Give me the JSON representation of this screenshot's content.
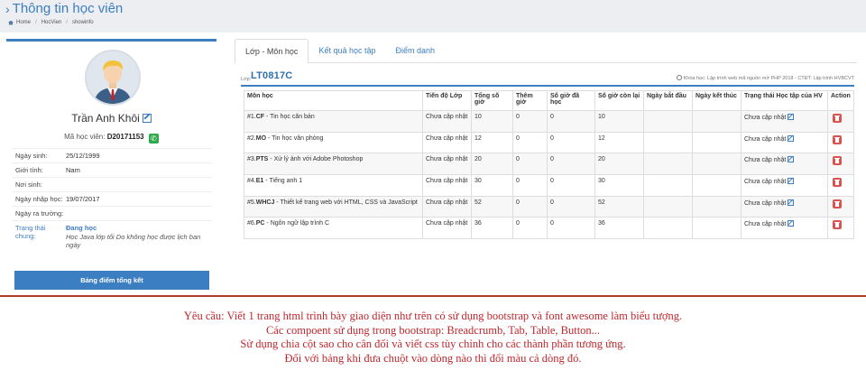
{
  "header": {
    "title": "Thông tin học viên",
    "breadcrumb": [
      "Home",
      "HocVien",
      "showinfo"
    ]
  },
  "profile": {
    "name": "Trần Anh Khôi",
    "code_label": "Mã học viên:",
    "code": "D20171153",
    "fields": [
      {
        "label": "Ngày sinh:",
        "value": "25/12/1999"
      },
      {
        "label": "Giới tính:",
        "value": "Nam"
      },
      {
        "label": "Nơi sinh:",
        "value": ""
      },
      {
        "label": "Ngày nhập học:",
        "value": "19/07/2017"
      },
      {
        "label": "Ngày ra trường:",
        "value": ""
      }
    ],
    "status_label": "Trạng thái chung:",
    "status_value": "Đang học",
    "status_note": "Học Java lớp tối Do không học được lịch ban ngày",
    "summary_button": "Bảng điểm tổng kết"
  },
  "tabs": [
    "Lớp - Môn học",
    "Kết quả học tập",
    "Điểm danh"
  ],
  "class_info": {
    "label": "Lớp:",
    "code": "LT0817C",
    "course": "Khóa học: Lập trình web mã nguồn mở PHP 2018 - CTĐT: Lập trình HVBCVT"
  },
  "table": {
    "headers": [
      "Môn học",
      "Tiến độ Lớp",
      "Tổng số giờ",
      "Thêm giờ",
      "Số giờ đã học",
      "Số giờ còn lại",
      "Ngày bắt đầu",
      "Ngày kết thúc",
      "Trạng thái Học tập của HV",
      "Action"
    ],
    "rows": [
      {
        "prefix": "#1.",
        "code": "CF",
        "name": " - Tin học căn bản",
        "progress": "Chưa cập nhật",
        "total": "10",
        "extra": "0",
        "done": "0",
        "remain": "10",
        "start": "",
        "end": "",
        "status": "Chưa cập nhật"
      },
      {
        "prefix": "#2.",
        "code": "MO",
        "name": " - Tin học văn phòng",
        "progress": "Chưa cập nhật",
        "total": "12",
        "extra": "0",
        "done": "0",
        "remain": "12",
        "start": "",
        "end": "",
        "status": "Chưa cập nhật"
      },
      {
        "prefix": "#3.",
        "code": "PTS",
        "name": " - Xử lý ảnh với Adobe Photoshop",
        "progress": "Chưa cập nhật",
        "total": "20",
        "extra": "0",
        "done": "0",
        "remain": "20",
        "start": "",
        "end": "",
        "status": "Chưa cập nhật"
      },
      {
        "prefix": "#4.",
        "code": "E1",
        "name": " - Tiếng anh 1",
        "progress": "Chưa cập nhật",
        "total": "30",
        "extra": "0",
        "done": "0",
        "remain": "30",
        "start": "",
        "end": "",
        "status": "Chưa cập nhật"
      },
      {
        "prefix": "#5.",
        "code": "WHCJ",
        "name": " - Thiết kế trang web với HTML, CSS và JavaScript",
        "progress": "Chưa cập nhật",
        "total": "52",
        "extra": "0",
        "done": "0",
        "remain": "52",
        "start": "",
        "end": "",
        "status": "Chưa cập nhật"
      },
      {
        "prefix": "#6.",
        "code": "PC",
        "name": " - Ngôn ngữ lập trình C",
        "progress": "Chưa cập nhật",
        "total": "36",
        "extra": "0",
        "done": "0",
        "remain": "36",
        "start": "",
        "end": "",
        "status": "Chưa cập nhật"
      }
    ]
  },
  "requirements": [
    "Yêu cầu: Viết 1 trang html trình bày giao diện như trên có sử dụng bootstrap và font awesome làm biểu tượng.",
    "Các compoent sử dụng trong bootstrap: Breadcrumb, Tab, Table, Button...",
    "Sử dụng chia cột sao cho cân đối và viết css tùy chỉnh cho các thành phần tương ứng.",
    "Đối với bảng khi đưa chuột vào dòng nào thì đổi màu cả dòng đó."
  ],
  "colors": {
    "accent": "#3c7ec2",
    "danger": "#d9534f",
    "success": "#2eaa4a",
    "requirement_text": "#c0272d"
  }
}
